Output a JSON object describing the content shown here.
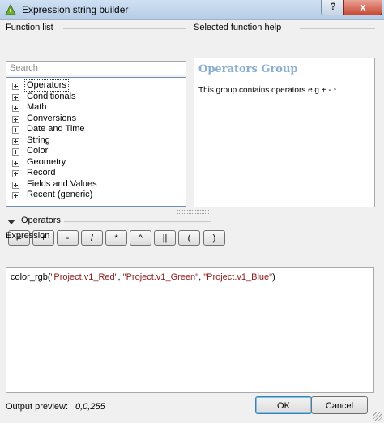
{
  "window": {
    "title": "Expression string builder",
    "help_glyph": "?",
    "close_glyph": "x"
  },
  "function_list": {
    "label": "Function list",
    "search_placeholder": "Search",
    "items": [
      {
        "label": "Operators",
        "selected": true
      },
      {
        "label": "Conditionals"
      },
      {
        "label": "Math"
      },
      {
        "label": "Conversions"
      },
      {
        "label": "Date and Time"
      },
      {
        "label": "String"
      },
      {
        "label": "Color"
      },
      {
        "label": "Geometry"
      },
      {
        "label": "Record"
      },
      {
        "label": "Fields and Values"
      },
      {
        "label": "Recent (generic)"
      }
    ]
  },
  "function_help": {
    "label": "Selected function help",
    "title": "Operators Group",
    "body": "This group contains operators e.g + - *"
  },
  "operators": {
    "label": "Operators",
    "buttons": [
      "=",
      "+",
      "-",
      "/",
      "*",
      "^",
      "||",
      "(",
      ")"
    ]
  },
  "expression": {
    "label": "Expression",
    "function_name": "color_rgb(",
    "arg1": "\"Project.v1_Red\"",
    "sep1": ", ",
    "arg2": "\"Project.v1_Green\"",
    "sep2": ", ",
    "arg3": "\"Project.v1_Blue\"",
    "close": ")"
  },
  "output_preview": {
    "label": "Output preview:",
    "value": "0,0,255"
  },
  "dialog_buttons": {
    "ok": "OK",
    "cancel": "Cancel"
  },
  "colors": {
    "help_title": "#8aaed0",
    "string_literal": "#8a1a1a",
    "close_button": "#c84a34"
  },
  "icons": [
    "qgis-expression-icon",
    "help-icon",
    "close-icon",
    "expand-icon",
    "collapse-arrow-icon",
    "size-grip-icon"
  ]
}
